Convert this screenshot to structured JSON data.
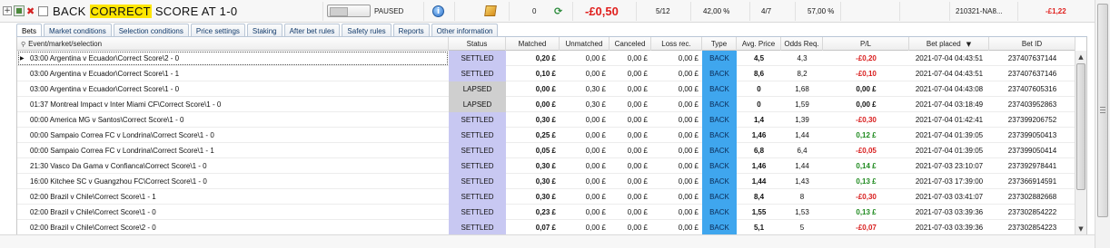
{
  "strategy": {
    "expander": "+",
    "title_before": "BACK ",
    "title_highlight": "CORRECT",
    "title_after": " SCORE AT 1-0",
    "state": "PAUSED",
    "count": "0",
    "profit_loss": "-£0,50",
    "bets_ratio": "5/12",
    "bets_pct": "42,00 %",
    "wins_ratio": "4/7",
    "wins_pct": "57,00 %",
    "id": "210321-NA8...",
    "profit_loss_2": "-£1,22",
    "colors": {
      "loss": "#e0201e",
      "highlight": "#ffe600"
    }
  },
  "tabs": [
    "Bets",
    "Market conditions",
    "Selection conditions",
    "Price settings",
    "Staking",
    "After bet rules",
    "Safety rules",
    "Reports",
    "Other information"
  ],
  "active_tab": "Bets",
  "columns": {
    "event": "Event/market/selection",
    "status": "Status",
    "matched": "Matched",
    "unmatched": "Unmatched",
    "canceled": "Canceled",
    "loss_rec": "Loss rec.",
    "type": "Type",
    "avg_price": "Avg. Price",
    "odds_req": "Odds Req.",
    "pl": "P/L",
    "bet_placed": "Bet placed",
    "bet_id": "Bet ID"
  },
  "rows": [
    {
      "event": "03:00 Argentina v Ecuador\\Correct Score\\2 - 0",
      "status": "SETTLED",
      "matched": "0,20 £",
      "unmatched": "0,00 £",
      "canceled": "0,00 £",
      "loss_rec": "0,00 £",
      "type": "BACK",
      "avg_price": "4,5",
      "odds_req": "4,3",
      "pl": "-£0,20",
      "pl_sign": "neg",
      "bet_placed": "2021-07-04 04:43:51",
      "bet_id": "237407637144",
      "selected": true
    },
    {
      "event": "03:00 Argentina v Ecuador\\Correct Score\\1 - 1",
      "status": "SETTLED",
      "matched": "0,10 £",
      "unmatched": "0,00 £",
      "canceled": "0,00 £",
      "loss_rec": "0,00 £",
      "type": "BACK",
      "avg_price": "8,6",
      "odds_req": "8,2",
      "pl": "-£0,10",
      "pl_sign": "neg",
      "bet_placed": "2021-07-04 04:43:51",
      "bet_id": "237407637146"
    },
    {
      "event": "03:00 Argentina v Ecuador\\Correct Score\\1 - 0",
      "status": "LAPSED",
      "matched": "0,00 £",
      "unmatched": "0,30 £",
      "canceled": "0,00 £",
      "loss_rec": "0,00 £",
      "type": "BACK",
      "avg_price": "0",
      "odds_req": "1,68",
      "pl": "0,00 £",
      "pl_sign": "zero",
      "bet_placed": "2021-07-04 04:43:08",
      "bet_id": "237407605316"
    },
    {
      "event": "01:37 Montreal Impact v Inter Miami CF\\Correct Score\\1 - 0",
      "status": "LAPSED",
      "matched": "0,00 £",
      "unmatched": "0,30 £",
      "canceled": "0,00 £",
      "loss_rec": "0,00 £",
      "type": "BACK",
      "avg_price": "0",
      "odds_req": "1,59",
      "pl": "0,00 £",
      "pl_sign": "zero",
      "bet_placed": "2021-07-04 03:18:49",
      "bet_id": "237403952863"
    },
    {
      "event": "00:00 America MG v Santos\\Correct Score\\1 - 0",
      "status": "SETTLED",
      "matched": "0,30 £",
      "unmatched": "0,00 £",
      "canceled": "0,00 £",
      "loss_rec": "0,00 £",
      "type": "BACK",
      "avg_price": "1,4",
      "odds_req": "1,39",
      "pl": "-£0,30",
      "pl_sign": "neg",
      "bet_placed": "2021-07-04 01:42:41",
      "bet_id": "237399206752"
    },
    {
      "event": "00:00 Sampaio Correa FC v Londrina\\Correct Score\\1 - 0",
      "status": "SETTLED",
      "matched": "0,25 £",
      "unmatched": "0,00 £",
      "canceled": "0,00 £",
      "loss_rec": "0,00 £",
      "type": "BACK",
      "avg_price": "1,46",
      "odds_req": "1,44",
      "pl": "0,12 £",
      "pl_sign": "pos",
      "bet_placed": "2021-07-04 01:39:05",
      "bet_id": "237399050413"
    },
    {
      "event": "00:00 Sampaio Correa FC v Londrina\\Correct Score\\1 - 1",
      "status": "SETTLED",
      "matched": "0,05 £",
      "unmatched": "0,00 £",
      "canceled": "0,00 £",
      "loss_rec": "0,00 £",
      "type": "BACK",
      "avg_price": "6,8",
      "odds_req": "6,4",
      "pl": "-£0,05",
      "pl_sign": "neg",
      "bet_placed": "2021-07-04 01:39:05",
      "bet_id": "237399050414"
    },
    {
      "event": "21:30 Vasco Da Gama v Confianca\\Correct Score\\1 - 0",
      "status": "SETTLED",
      "matched": "0,30 £",
      "unmatched": "0,00 £",
      "canceled": "0,00 £",
      "loss_rec": "0,00 £",
      "type": "BACK",
      "avg_price": "1,46",
      "odds_req": "1,44",
      "pl": "0,14 £",
      "pl_sign": "pos",
      "bet_placed": "2021-07-03 23:10:07",
      "bet_id": "237392978441"
    },
    {
      "event": "16:00 Kitchee SC v Guangzhou FC\\Correct Score\\1 - 0",
      "status": "SETTLED",
      "matched": "0,30 £",
      "unmatched": "0,00 £",
      "canceled": "0,00 £",
      "loss_rec": "0,00 £",
      "type": "BACK",
      "avg_price": "1,44",
      "odds_req": "1,43",
      "pl": "0,13 £",
      "pl_sign": "pos",
      "bet_placed": "2021-07-03 17:39:00",
      "bet_id": "237366914591"
    },
    {
      "event": "02:00 Brazil v Chile\\Correct Score\\1 - 1",
      "status": "SETTLED",
      "matched": "0,30 £",
      "unmatched": "0,00 £",
      "canceled": "0,00 £",
      "loss_rec": "0,00 £",
      "type": "BACK",
      "avg_price": "8,4",
      "odds_req": "8",
      "pl": "-£0,30",
      "pl_sign": "neg",
      "bet_placed": "2021-07-03 03:41:07",
      "bet_id": "237302882668"
    },
    {
      "event": "02:00 Brazil v Chile\\Correct Score\\1 - 0",
      "status": "SETTLED",
      "matched": "0,23 £",
      "unmatched": "0,00 £",
      "canceled": "0,00 £",
      "loss_rec": "0,00 £",
      "type": "BACK",
      "avg_price": "1,55",
      "odds_req": "1,53",
      "pl": "0,13 £",
      "pl_sign": "pos",
      "bet_placed": "2021-07-03 03:39:36",
      "bet_id": "237302854222"
    },
    {
      "event": "02:00 Brazil v Chile\\Correct Score\\2 - 0",
      "status": "SETTLED",
      "matched": "0,07 £",
      "unmatched": "0,00 £",
      "canceled": "0,00 £",
      "loss_rec": "0,00 £",
      "type": "BACK",
      "avg_price": "5,1",
      "odds_req": "5",
      "pl": "-£0,07",
      "pl_sign": "neg",
      "bet_placed": "2021-07-03 03:39:36",
      "bet_id": "237302854223"
    }
  ],
  "icons": [
    "expand-icon",
    "strategy-icon",
    "delete-icon",
    "info-icon",
    "edit-icon",
    "refresh-icon",
    "sort-desc-icon",
    "row-pointer-icon",
    "search-icon"
  ]
}
